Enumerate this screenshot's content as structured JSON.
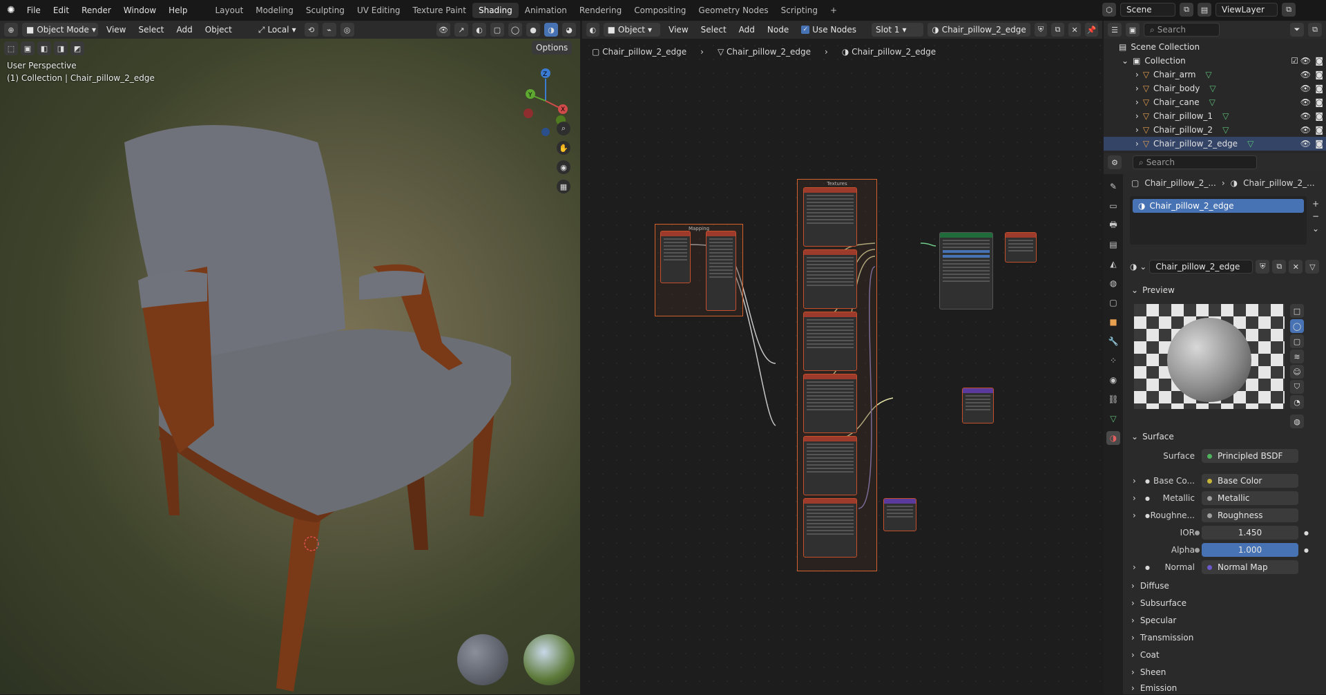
{
  "menu": {
    "file": "File",
    "edit": "Edit",
    "render": "Render",
    "window": "Window",
    "help": "Help"
  },
  "workspaces": [
    "Layout",
    "Modeling",
    "Sculpting",
    "UV Editing",
    "Texture Paint",
    "Shading",
    "Animation",
    "Rendering",
    "Compositing",
    "Geometry Nodes",
    "Scripting"
  ],
  "active_workspace": "Shading",
  "scene": {
    "label": "Scene",
    "view_layer": "ViewLayer"
  },
  "viewport": {
    "mode": "Object Mode",
    "view": "View",
    "select": "Select",
    "add": "Add",
    "object": "Object",
    "orientation": "Local",
    "options": "Options",
    "perspective": "User Perspective",
    "collection_path": "(1) Collection | Chair_pillow_2_edge"
  },
  "node_editor": {
    "object_dd": "Object",
    "view": "View",
    "select": "Select",
    "add": "Add",
    "node": "Node",
    "use_nodes": "Use Nodes",
    "slot": "Slot 1",
    "material": "Chair_pillow_2_edge",
    "breadcrumb": [
      "Chair_pillow_2_edge",
      "Chair_pillow_2_edge",
      "Chair_pillow_2_edge"
    ],
    "frame_mapping": "Mapping",
    "frame_textures": "Textures"
  },
  "outliner": {
    "search_placeholder": "Search",
    "scene_collection": "Scene Collection",
    "collection": "Collection",
    "items": [
      "Chair_arm",
      "Chair_body",
      "Chair_cane",
      "Chair_pillow_1",
      "Chair_pillow_2",
      "Chair_pillow_2_edge"
    ]
  },
  "properties": {
    "search_placeholder": "Search",
    "crumb_object": "Chair_pillow_2_...",
    "crumb_material": "Chair_pillow_2_...",
    "slot_name": "Chair_pillow_2_edge",
    "material_name": "Chair_pillow_2_edge",
    "preview": "Preview",
    "surface_section": "Surface",
    "rows": [
      {
        "label": "Surface",
        "value": "Principled BSDF",
        "dot": "#4fb35c"
      },
      {
        "label": "Base Co...",
        "value": "Base Color",
        "dot": "#c7b53a"
      },
      {
        "label": "Metallic",
        "value": "Metallic",
        "dot": "#a0a0a0"
      },
      {
        "label": "Roughne...",
        "value": "Roughness",
        "dot": "#a0a0a0"
      },
      {
        "label": "IOR",
        "value": "1.450",
        "dot": "#a0a0a0"
      },
      {
        "label": "Alpha",
        "value": "1.000",
        "dot": "#a0a0a0"
      },
      {
        "label": "Normal",
        "value": "Normal Map",
        "dot": "#6a5acd"
      }
    ],
    "subsections": [
      "Diffuse",
      "Subsurface",
      "Specular",
      "Transmission",
      "Coat",
      "Sheen",
      "Emission"
    ]
  },
  "colors": {
    "accent": "#4772b3",
    "node_border": "#c6502b",
    "selection": "#4772b3"
  }
}
